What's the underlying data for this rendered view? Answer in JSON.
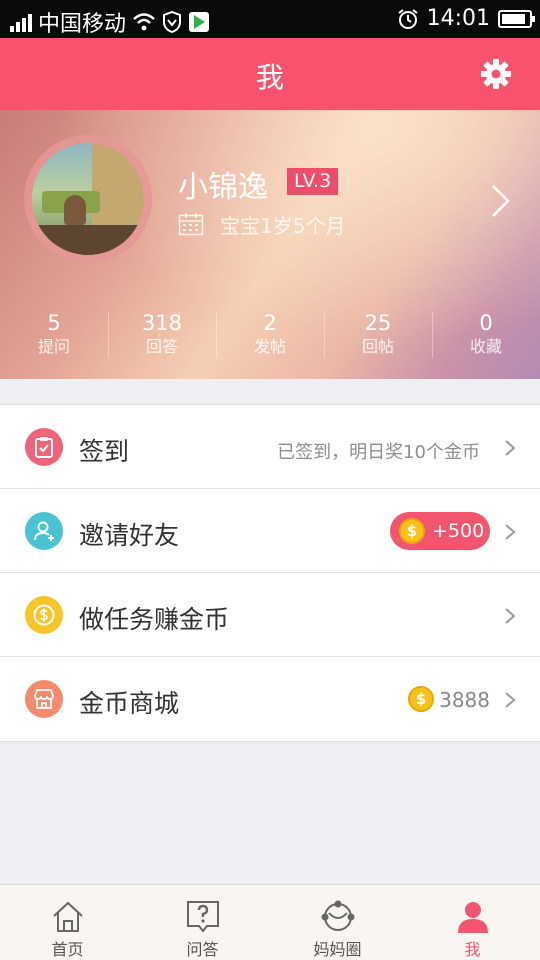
{
  "status_bar": {
    "carrier": "中国移动",
    "time": "14:01",
    "battery_level": 0.9,
    "icons": [
      "signal-icon",
      "wifi-icon",
      "vpn-shield-icon",
      "play-store-icon",
      "alarm-icon",
      "battery-icon"
    ]
  },
  "header": {
    "title": "我",
    "settings_icon": "gear-icon"
  },
  "profile": {
    "username": "小锦逸",
    "level": "LV.3",
    "baby_age": "宝宝1岁5个月",
    "stats": [
      {
        "value": "5",
        "label": "提问"
      },
      {
        "value": "318",
        "label": "回答"
      },
      {
        "value": "2",
        "label": "发帖"
      },
      {
        "value": "25",
        "label": "回帖"
      },
      {
        "value": "0",
        "label": "收藏"
      }
    ]
  },
  "menu": [
    {
      "label": "签到",
      "note": "已签到，明日奖10个金币",
      "icon": "clipboard-check-icon",
      "color": "#f0637a"
    },
    {
      "label": "邀请好友",
      "badge": "+500",
      "icon": "add-user-icon",
      "color": "#49c2d1"
    },
    {
      "label": "做任务赚金币",
      "icon": "dollar-coin-icon",
      "color": "#f7c52a"
    },
    {
      "label": "金币商城",
      "coins": "3888",
      "icon": "shop-icon",
      "color": "#f58a6c"
    }
  ],
  "tabbar": [
    {
      "label": "首页",
      "icon": "home-icon",
      "active": false
    },
    {
      "label": "问答",
      "icon": "question-bubble-icon",
      "active": false
    },
    {
      "label": "妈妈圈",
      "icon": "circle-network-icon",
      "active": false
    },
    {
      "label": "我",
      "icon": "person-icon",
      "active": true
    }
  ],
  "colors": {
    "accent": "#f7536f",
    "active_tab": "#f2556f",
    "background": "#efeef3"
  }
}
